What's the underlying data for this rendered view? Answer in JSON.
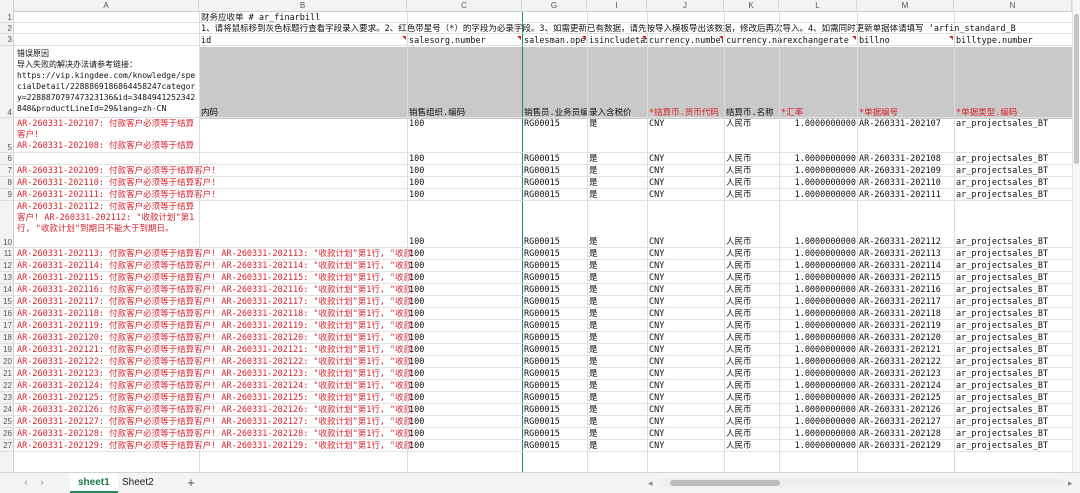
{
  "columns": [
    "A",
    "B",
    "C",
    "G",
    "I",
    "J",
    "K",
    "L",
    "M",
    "N"
  ],
  "row_numbers": [
    "1",
    "2",
    "3",
    "4",
    "5",
    "6",
    "7",
    "8",
    "9",
    "10",
    "11",
    "12",
    "13",
    "14",
    "15",
    "16",
    "17",
    "18",
    "19",
    "20",
    "21",
    "22",
    "23",
    "24",
    "25",
    "26",
    "27"
  ],
  "row1_b": "财务应收单 # ar_finarbill",
  "row2_b": "1、请将鼠标移到灰色标题行查看字段录入要求。2、红色带星号（*）的字段为必录字段。3、如需更新已有数据，请先按导入模板导出该数据，修改后再次导入。4、如需同时更新单据体请填写 ‘arfin_standard_B",
  "row3": {
    "B": "id",
    "C": "salesorg.number",
    "G": "salesman.operatornumber",
    "I": "isincludetax",
    "J": "currency.number",
    "K": "currency.narexchangerate",
    "M": "billno",
    "N": "billtype.number"
  },
  "error_note": "错误原因\n导入失败的解决办法请参考链接：\nhttps://vip.kingdee.com/knowledge/specialDetail/2288869186864458247category=228887079747323136&id=3484941252342848&productLineId=29&lang=zh-CN",
  "row4": {
    "B": "内码",
    "C": "销售组织.编码",
    "G": "销售员.业务员编码",
    "I": "录入含税价",
    "J": "*结算币.货币代码",
    "K": "结算币.名称",
    "L": "*汇率",
    "M": "*单据编号",
    "N": "*单据类型.编码"
  },
  "rows": [
    {
      "n": "5",
      "err": "AR-260331-202107: 付款客户必须等于结算客户!\nAR-260331-202108: 付款客户必须等于结算客户!",
      "C": "100",
      "G": "RG00015",
      "I": "是",
      "J": "CNY",
      "K": "人民币",
      "L": "1.0000000000",
      "M": "AR-260331-202107",
      "N": "ar_projectsales_BT",
      "top": true
    },
    {
      "n": "6",
      "err": "",
      "C": "100",
      "G": "RG00015",
      "I": "是",
      "J": "CNY",
      "K": "人民币",
      "L": "1.0000000000",
      "M": "AR-260331-202108",
      "N": "ar_projectsales_BT"
    },
    {
      "n": "7",
      "err": "AR-260331-202109: 付款客户必须等于结算客户!",
      "C": "100",
      "G": "RG00015",
      "I": "是",
      "J": "CNY",
      "K": "人民币",
      "L": "1.0000000000",
      "M": "AR-260331-202109",
      "N": "ar_projectsales_BT"
    },
    {
      "n": "8",
      "err": "AR-260331-202110: 付款客户必须等于结算客户!",
      "C": "100",
      "G": "RG00015",
      "I": "是",
      "J": "CNY",
      "K": "人民币",
      "L": "1.0000000000",
      "M": "AR-260331-202110",
      "N": "ar_projectsales_BT"
    },
    {
      "n": "9",
      "err": "AR-260331-202111: 付款客户必须等于结算客户!",
      "C": "100",
      "G": "RG00015",
      "I": "是",
      "J": "CNY",
      "K": "人民币",
      "L": "1.0000000000",
      "M": "AR-260331-202111",
      "N": "ar_projectsales_BT"
    },
    {
      "n": "10",
      "err": "AR-260331-202112: 付款客户必须等于结算客户! AR-260331-202112: \"收款计划\"第1行, \"收款计划\"到期日不能大于到期日。",
      "C": "100",
      "G": "RG00015",
      "I": "是",
      "J": "CNY",
      "K": "人民币",
      "L": "1.0000000000",
      "M": "AR-260331-202112",
      "N": "ar_projectsales_BT"
    },
    {
      "n": "11",
      "err": "AR-260331-202113: 付款客户必须等于结算客户! AR-260331-202113: \"收款计划\"第1行, \"收款",
      "C": "100",
      "G": "RG00015",
      "I": "是",
      "J": "CNY",
      "K": "人民币",
      "L": "1.0000000000",
      "M": "AR-260331-202113",
      "N": "ar_projectsales_BT"
    },
    {
      "n": "12",
      "err": "AR-260331-202114: 付款客户必须等于结算客户! AR-260331-202114: \"收款计划\"第1行, \"收款",
      "C": "100",
      "G": "RG00015",
      "I": "是",
      "J": "CNY",
      "K": "人民币",
      "L": "1.0000000000",
      "M": "AR-260331-202114",
      "N": "ar_projectsales_BT"
    },
    {
      "n": "13",
      "err": "AR-260331-202115: 付款客户必须等于结算客户! AR-260331-202115: \"收款计划\"第1行, \"收款",
      "C": "100",
      "G": "RG00015",
      "I": "是",
      "J": "CNY",
      "K": "人民币",
      "L": "1.0000000000",
      "M": "AR-260331-202115",
      "N": "ar_projectsales_BT"
    },
    {
      "n": "14",
      "err": "AR-260331-202116: 付款客户必须等于结算客户! AR-260331-202116: \"收款计划\"第1行, \"收款",
      "C": "100",
      "G": "RG00015",
      "I": "是",
      "J": "CNY",
      "K": "人民币",
      "L": "1.0000000000",
      "M": "AR-260331-202116",
      "N": "ar_projectsales_BT"
    },
    {
      "n": "15",
      "err": "AR-260331-202117: 付款客户必须等于结算客户! AR-260331-202117: \"收款计划\"第1行, \"收款",
      "C": "100",
      "G": "RG00015",
      "I": "是",
      "J": "CNY",
      "K": "人民币",
      "L": "1.0000000000",
      "M": "AR-260331-202117",
      "N": "ar_projectsales_BT"
    },
    {
      "n": "16",
      "err": "AR-260331-202118: 付款客户必须等于结算客户! AR-260331-202118: \"收款计划\"第1行, \"收款",
      "C": "100",
      "G": "RG00015",
      "I": "是",
      "J": "CNY",
      "K": "人民币",
      "L": "1.0000000000",
      "M": "AR-260331-202118",
      "N": "ar_projectsales_BT"
    },
    {
      "n": "17",
      "err": "AR-260331-202119: 付款客户必须等于结算客户! AR-260331-202119: \"收款计划\"第1行, \"收款",
      "C": "100",
      "G": "RG00015",
      "I": "是",
      "J": "CNY",
      "K": "人民币",
      "L": "1.0000000000",
      "M": "AR-260331-202119",
      "N": "ar_projectsales_BT"
    },
    {
      "n": "18",
      "err": "AR-260331-202120: 付款客户必须等于结算客户! AR-260331-202120: \"收款计划\"第1行, \"收款",
      "C": "100",
      "G": "RG00015",
      "I": "是",
      "J": "CNY",
      "K": "人民币",
      "L": "1.0000000000",
      "M": "AR-260331-202120",
      "N": "ar_projectsales_BT"
    },
    {
      "n": "19",
      "err": "AR-260331-202121: 付款客户必须等于结算客户! AR-260331-202121: \"收款计划\"第1行, \"收款",
      "C": "100",
      "G": "RG00015",
      "I": "是",
      "J": "CNY",
      "K": "人民币",
      "L": "1.0000000000",
      "M": "AR-260331-202121",
      "N": "ar_projectsales_BT"
    },
    {
      "n": "20",
      "err": "AR-260331-202122: 付款客户必须等于结算客户! AR-260331-202122: \"收款计划\"第1行, \"收款",
      "C": "100",
      "G": "RG00015",
      "I": "是",
      "J": "CNY",
      "K": "人民币",
      "L": "1.0000000000",
      "M": "AR-260331-202122",
      "N": "ar_projectsales_BT"
    },
    {
      "n": "21",
      "err": "AR-260331-202123: 付款客户必须等于结算客户! AR-260331-202123: \"收款计划\"第1行, \"收款",
      "C": "100",
      "G": "RG00015",
      "I": "是",
      "J": "CNY",
      "K": "人民币",
      "L": "1.0000000000",
      "M": "AR-260331-202123",
      "N": "ar_projectsales_BT"
    },
    {
      "n": "22",
      "err": "AR-260331-202124: 付款客户必须等于结算客户! AR-260331-202124: \"收款计划\"第1行, \"收款",
      "C": "100",
      "G": "RG00015",
      "I": "是",
      "J": "CNY",
      "K": "人民币",
      "L": "1.0000000000",
      "M": "AR-260331-202124",
      "N": "ar_projectsales_BT"
    },
    {
      "n": "23",
      "err": "AR-260331-202125: 付款客户必须等于结算客户! AR-260331-202125: \"收款计划\"第1行, \"收款",
      "C": "100",
      "G": "RG00015",
      "I": "是",
      "J": "CNY",
      "K": "人民币",
      "L": "1.0000000000",
      "M": "AR-260331-202125",
      "N": "ar_projectsales_BT"
    },
    {
      "n": "24",
      "err": "AR-260331-202126: 付款客户必须等于结算客户! AR-260331-202126: \"收款计划\"第1行, \"收款",
      "C": "100",
      "G": "RG00015",
      "I": "是",
      "J": "CNY",
      "K": "人民币",
      "L": "1.0000000000",
      "M": "AR-260331-202126",
      "N": "ar_projectsales_BT"
    },
    {
      "n": "25",
      "err": "AR-260331-202127: 付款客户必须等于结算客户! AR-260331-202127: \"收款计划\"第1行, \"收款",
      "C": "100",
      "G": "RG00015",
      "I": "是",
      "J": "CNY",
      "K": "人民币",
      "L": "1.0000000000",
      "M": "AR-260331-202127",
      "N": "ar_projectsales_BT"
    },
    {
      "n": "26",
      "err": "AR-260331-202128: 付款客户必须等于结算客户! AR-260331-202128: \"收款计划\"第1行, \"收款",
      "C": "100",
      "G": "RG00015",
      "I": "是",
      "J": "CNY",
      "K": "人民币",
      "L": "1.0000000000",
      "M": "AR-260331-202128",
      "N": "ar_projectsales_BT"
    },
    {
      "n": "27",
      "err": "AR-260331-202129: 付款客户必须等于结算客户! AR-260331-202129: \"收款计划\"第1行, \"收款",
      "C": "100",
      "G": "RG00015",
      "I": "是",
      "J": "CNY",
      "K": "人民币",
      "L": "1.0000000000",
      "M": "AR-260331-202129",
      "N": "ar_projectsales_BT"
    }
  ],
  "tabs": {
    "sheet1": "sheet1",
    "sheet2": "Sheet2",
    "add": "+"
  },
  "nav": {
    "prev": "‹",
    "next": "›",
    "left": "◂",
    "right": "▸"
  },
  "colors": {
    "error_red": "#d8222c",
    "header_gray": "#c9c9c9",
    "frozen_line": "#1f8a52"
  }
}
